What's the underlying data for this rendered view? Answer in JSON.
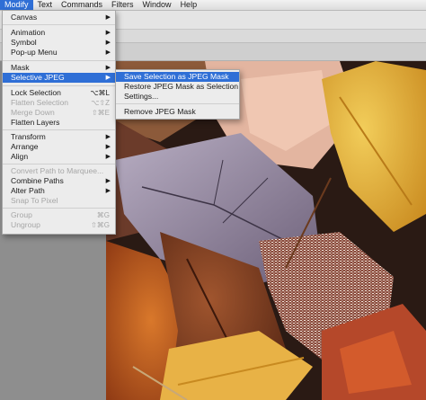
{
  "menubar": [
    "Modify",
    "Text",
    "Commands",
    "Filters",
    "Window",
    "Help"
  ],
  "modify_menu": {
    "items": [
      {
        "label": "Canvas",
        "submenu": true
      },
      {
        "label": "Animation",
        "submenu": true
      },
      {
        "label": "Symbol",
        "submenu": true
      },
      {
        "label": "Pop-up Menu",
        "submenu": true
      },
      {
        "label": "Mask",
        "submenu": true
      },
      {
        "label": "Selective JPEG",
        "submenu": true
      },
      {
        "label": "Lock Selection",
        "shortcut": "⌥⌘L"
      },
      {
        "label": "Flatten Selection",
        "shortcut": "⌥⇧Z"
      },
      {
        "label": "Merge Down",
        "shortcut": "⇧⌘E"
      },
      {
        "label": "Flatten Layers"
      },
      {
        "label": "Transform",
        "submenu": true
      },
      {
        "label": "Arrange",
        "submenu": true
      },
      {
        "label": "Align",
        "submenu": true
      },
      {
        "label": "Convert Path to Marquee..."
      },
      {
        "label": "Combine Paths",
        "submenu": true
      },
      {
        "label": "Alter Path",
        "submenu": true
      },
      {
        "label": "Snap To Pixel"
      },
      {
        "label": "Group",
        "shortcut": "⌘G"
      },
      {
        "label": "Ungroup",
        "shortcut": "⇧⌘G"
      }
    ]
  },
  "selective_jpeg_menu": {
    "items": [
      {
        "label": "Save Selection as JPEG Mask"
      },
      {
        "label": "Restore JPEG Mask as Selection"
      },
      {
        "label": "Settings..."
      },
      {
        "label": "Remove JPEG Mask"
      }
    ]
  },
  "colors": {
    "menu_highlight": "#2f6fd6",
    "menu_bg": "#ececec",
    "disabled_text": "#a6a6a6"
  }
}
